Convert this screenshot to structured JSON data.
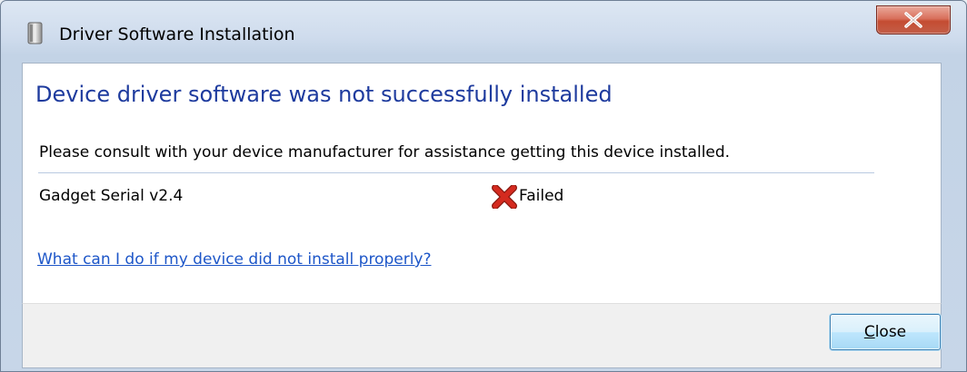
{
  "window": {
    "title": "Driver Software Installation",
    "close_icon": "close-x-icon",
    "app_icon": "device-icon"
  },
  "main": {
    "heading": "Device driver software was not successfully installed",
    "message": "Please consult with your device manufacturer for assistance getting this device installed.",
    "device": {
      "name": "Gadget Serial v2.4",
      "status_icon": "red-x-icon",
      "status": "Failed"
    },
    "help_link": "What can I do if my device did not install properly?"
  },
  "footer": {
    "close_button_mnemonic": "C",
    "close_button_rest": "lose"
  },
  "colors": {
    "heading": "#1e3b9e",
    "link": "#1d56c8",
    "failed_icon": "#d42a1f"
  }
}
